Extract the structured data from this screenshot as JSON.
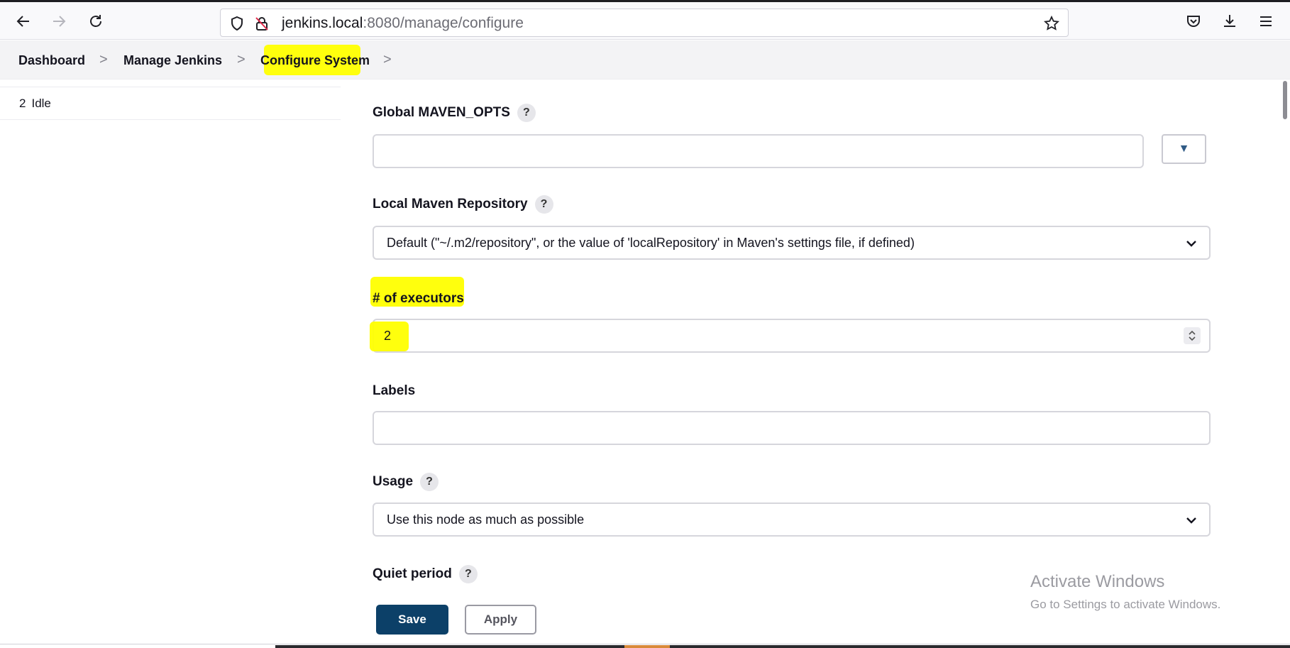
{
  "browser": {
    "url_host": "jenkins.local",
    "url_rest": ":8080/manage/configure",
    "icons": [
      "back-arrow-icon",
      "forward-arrow-icon",
      "reload-icon",
      "shield-icon",
      "insecure-lock-icon",
      "star-icon",
      "pocket-icon",
      "download-icon",
      "menu-icon"
    ]
  },
  "breadcrumb": {
    "items": [
      "Dashboard",
      "Manage Jenkins",
      "Configure System"
    ],
    "separator": ">"
  },
  "side_panel": {
    "executor_number": "2",
    "executor_status": "Idle"
  },
  "form": {
    "maven_opts": {
      "label": "Global MAVEN_OPTS",
      "help": "?",
      "value": "",
      "expand_icon": "▼"
    },
    "local_repo": {
      "label": "Local Maven Repository",
      "help": "?",
      "selected": "Default (\"~/.m2/repository\", or the value of 'localRepository' in Maven's settings file, if defined)"
    },
    "executors": {
      "label": "# of executors",
      "value": "2"
    },
    "labels": {
      "label": "Labels",
      "value": ""
    },
    "usage": {
      "label": "Usage",
      "help": "?",
      "selected": "Use this node as much as possible"
    },
    "quiet_period": {
      "label": "Quiet period",
      "help": "?"
    }
  },
  "actions": {
    "save": "Save",
    "apply": "Apply"
  },
  "watermark": {
    "title": "Activate Windows",
    "subtitle": "Go to Settings to activate Windows."
  },
  "colors": {
    "highlight": "#ffff00",
    "save_button": "#0c4068",
    "accent": "#2f5a85"
  }
}
